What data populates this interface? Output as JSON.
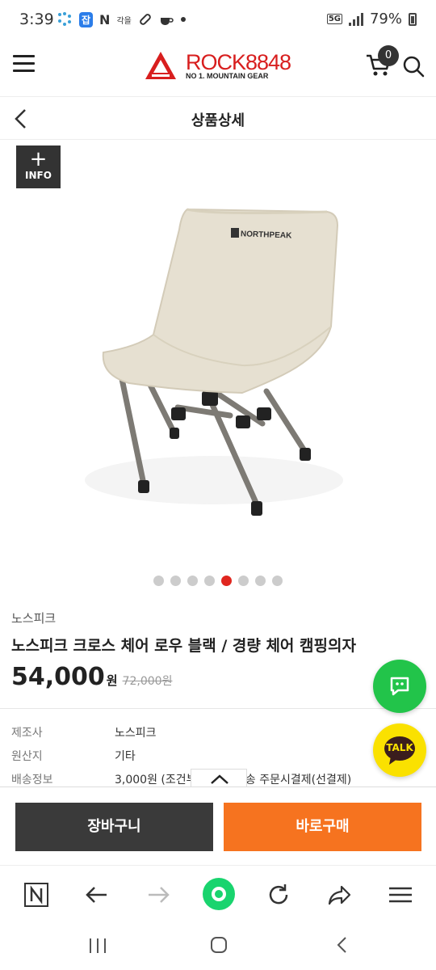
{
  "status_bar": {
    "time": "3:39",
    "network": "5G",
    "battery": "79%",
    "notif_labels": [
      "잡",
      "N",
      "각을"
    ]
  },
  "header": {
    "logo_text": "ROCK8848",
    "logo_sub": "NO 1. MOUNTAIN GEAR",
    "cart_count": "0"
  },
  "subheader": {
    "title": "상품상세"
  },
  "gallery": {
    "info_plus": "+",
    "info_label": "INFO",
    "dot_count": 8,
    "active_dot_index": 4,
    "chair_brand": "NORTHPEAK"
  },
  "product": {
    "brand": "노스피크",
    "name": "노스피크 크로스 체어 로우 블랙 / 경량 체어 캠핑의자",
    "price": "54,000",
    "price_unit": "원",
    "original_price": "72,000원"
  },
  "specs": [
    {
      "label": "제조사",
      "value": "노스피크"
    },
    {
      "label": "원산지",
      "value": "기타"
    },
    {
      "label": "배송정보",
      "value": "3,000원 (조건부                 별 추가배송 주문시결제(선결제)"
    }
  ],
  "floating": {
    "talk_label": "TALK"
  },
  "actions": {
    "cart_label": "장바구니",
    "buy_label": "바로구매"
  },
  "colors": {
    "brand_red": "#d81e1e",
    "buy_orange": "#f6731f",
    "cart_dark": "#3a3a3a",
    "chat_green": "#22c44a",
    "talk_yellow": "#fae100"
  }
}
